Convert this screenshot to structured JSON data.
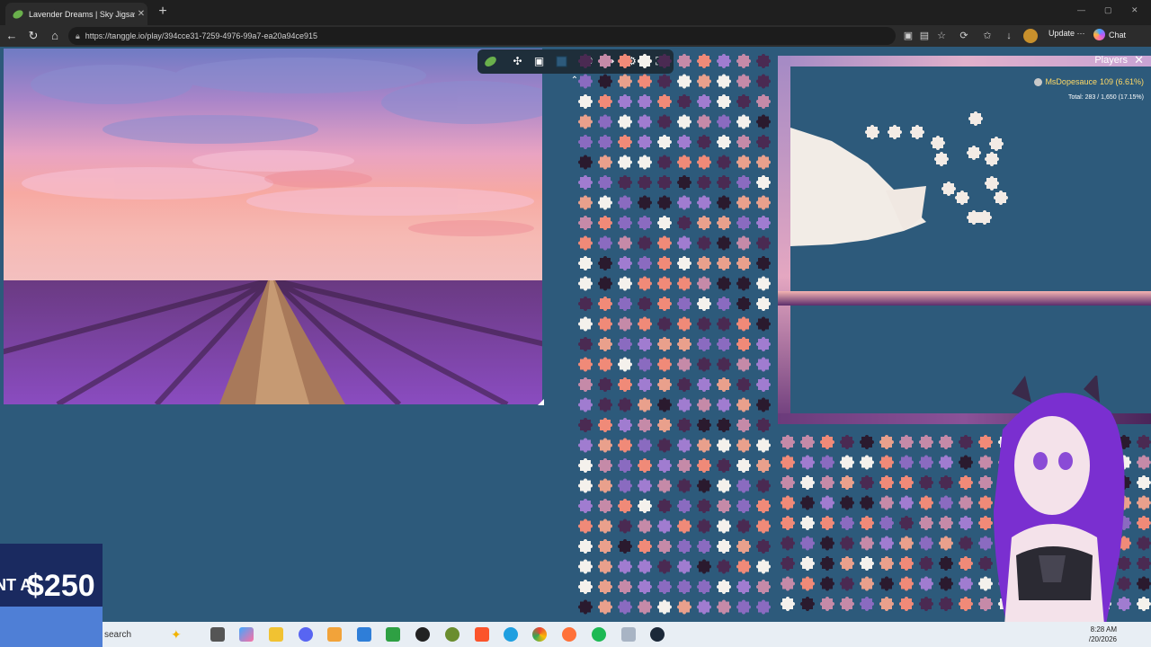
{
  "browser": {
    "tab": {
      "title": "Lavender Dreams | Sky Jigsaw",
      "close": "✕"
    },
    "new_tab": "+",
    "window_controls": {
      "minimize": "—",
      "maximize": "▢",
      "close": "✕"
    },
    "url": "https://tanggle.io/play/394cce31-7259-4976-99a7-ea20a94ce915",
    "update_label": "Update",
    "more_label": "···",
    "chat_label": "Chat"
  },
  "game": {
    "players_title": "Players",
    "player": {
      "name": "MsDopesauce",
      "stats": "109 (6.61%)"
    },
    "total_text": "Total: 283 / 1,650 (17.15%)",
    "toolbar_icons": [
      "leaf-icon",
      "puzzle-piece-icon",
      "image-icon",
      "color-swatch-icon",
      "players-icon",
      "share-icon",
      "settings-icon",
      "fullscreen-icon"
    ],
    "colors": {
      "table": "#2d5a7b",
      "toolbar": "#1e2e3a",
      "highlight": "#ffd966"
    }
  },
  "overlay": {
    "promo_text": "$250",
    "promo_prefix": "NT A"
  },
  "taskbar": {
    "search_label": "search",
    "time": "8:28 AM",
    "date": "/20/2026"
  }
}
